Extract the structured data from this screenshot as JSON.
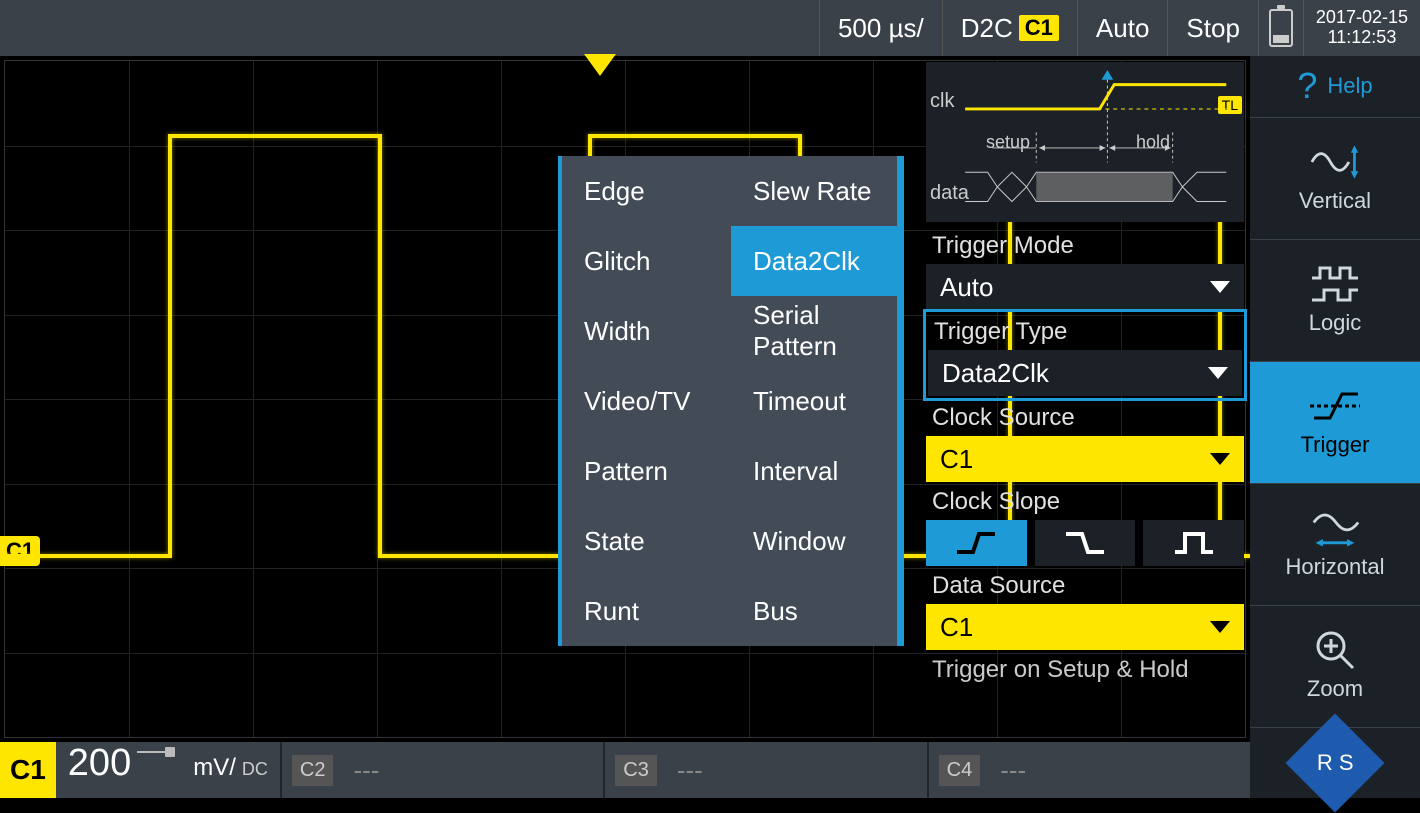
{
  "topbar": {
    "timebase": "500 µs/",
    "trigger_src": "D2C",
    "trigger_ch": "C1",
    "mode": "Auto",
    "run_state": "Stop",
    "date": "2017-02-15",
    "time": "11:12:53"
  },
  "sidebar": {
    "help": "Help",
    "items": [
      {
        "label": "Vertical"
      },
      {
        "label": "Logic"
      },
      {
        "label": "Trigger"
      },
      {
        "label": "Horizontal"
      },
      {
        "label": "Zoom"
      }
    ]
  },
  "popup": {
    "col1": [
      "Edge",
      "Glitch",
      "Width",
      "Video/TV",
      "Pattern",
      "State",
      "Runt"
    ],
    "col2": [
      "Slew Rate",
      "Data2Clk",
      "Serial Pattern",
      "Timeout",
      "Interval",
      "Window",
      "Bus"
    ],
    "selected": "Data2Clk"
  },
  "settings": {
    "diagram": {
      "clk": "clk",
      "setup": "setup",
      "hold": "hold",
      "data": "data",
      "tl": "TL"
    },
    "trigger_mode": {
      "label": "Trigger Mode",
      "value": "Auto"
    },
    "trigger_type": {
      "label": "Trigger Type",
      "value": "Data2Clk"
    },
    "clock_source": {
      "label": "Clock Source",
      "value": "C1"
    },
    "clock_slope": {
      "label": "Clock Slope"
    },
    "data_source": {
      "label": "Data Source",
      "value": "C1"
    },
    "setup_hold": {
      "label": "Trigger on Setup & Hold"
    }
  },
  "bottom": {
    "ch1": {
      "badge": "C1",
      "scale": "200",
      "unit": "mV/",
      "coupling": "DC"
    },
    "ch2": {
      "badge": "C2",
      "value": "---"
    },
    "ch3": {
      "badge": "C3",
      "value": "---"
    },
    "ch4": {
      "badge": "C4",
      "value": "---"
    }
  },
  "waveform": {
    "ch_marker": "C1"
  }
}
